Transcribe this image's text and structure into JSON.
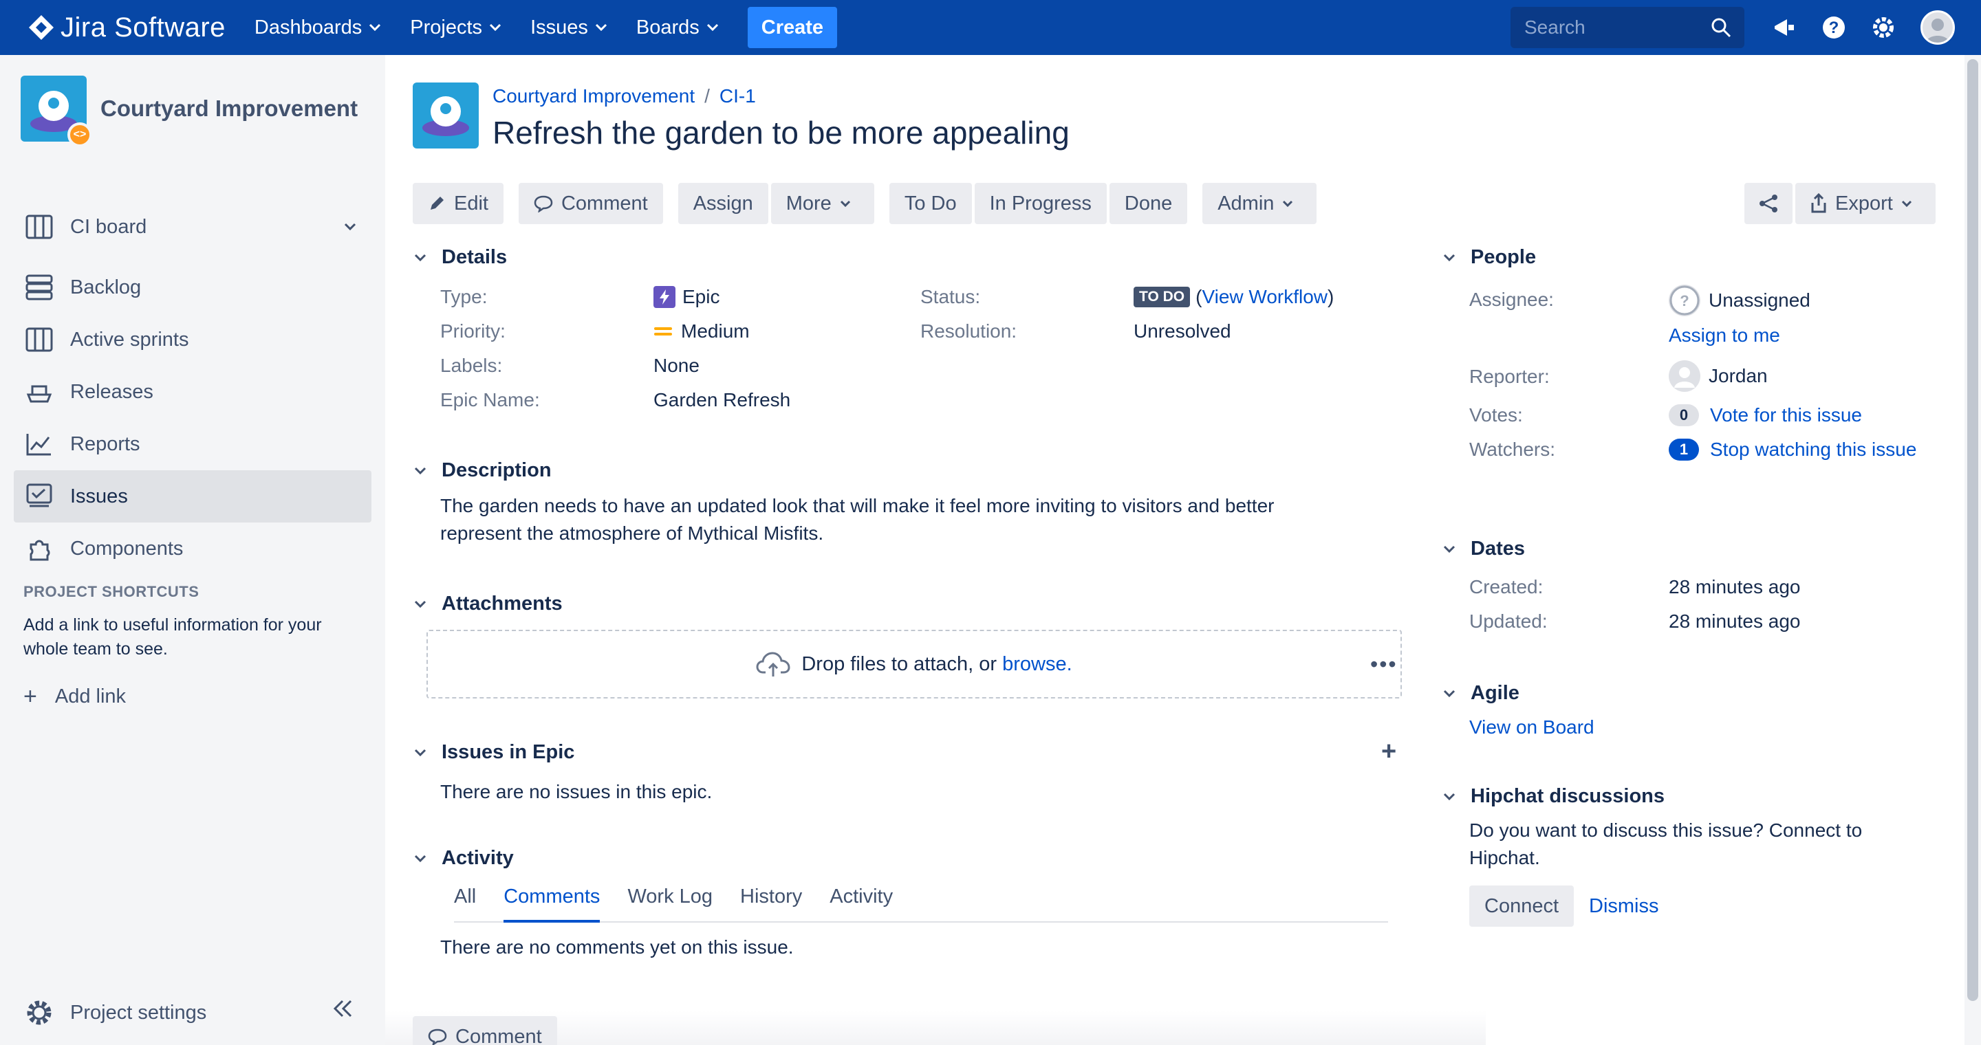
{
  "topnav": {
    "brand": "Jira Software",
    "items": [
      {
        "label": "Dashboards"
      },
      {
        "label": "Projects"
      },
      {
        "label": "Issues"
      },
      {
        "label": "Boards"
      }
    ],
    "create_label": "Create",
    "search_placeholder": "Search",
    "icons": [
      "notifications-icon",
      "help-icon",
      "settings-icon",
      "user-avatar"
    ]
  },
  "sidebar": {
    "project_name": "Courtyard Improvement",
    "board_label": "CI board",
    "items": [
      {
        "label": "Backlog",
        "icon": "backlog-icon"
      },
      {
        "label": "Active sprints",
        "icon": "board-icon"
      },
      {
        "label": "Releases",
        "icon": "ship-icon"
      },
      {
        "label": "Reports",
        "icon": "chart-icon"
      },
      {
        "label": "Issues",
        "icon": "issues-icon",
        "active": true
      },
      {
        "label": "Components",
        "icon": "puzzle-icon"
      }
    ],
    "shortcuts_title": "PROJECT SHORTCUTS",
    "shortcuts_text": "Add a link to useful information for your whole team to see.",
    "add_link": "Add link",
    "project_settings": "Project settings"
  },
  "issue": {
    "breadcrumb_project": "Courtyard Improvement",
    "breadcrumb_sep": "/",
    "key": "CI-1",
    "title": "Refresh the garden to be more appealing"
  },
  "toolbar": {
    "edit": "Edit",
    "comment": "Comment",
    "assign": "Assign",
    "more": "More",
    "todo": "To Do",
    "in_progress": "In Progress",
    "done": "Done",
    "admin": "Admin",
    "export": "Export"
  },
  "details": {
    "heading": "Details",
    "type_label": "Type:",
    "type_value": "Epic",
    "priority_label": "Priority:",
    "priority_value": "Medium",
    "labels_label": "Labels:",
    "labels_value": "None",
    "epic_name_label": "Epic Name:",
    "epic_name_value": "Garden Refresh",
    "status_label": "Status:",
    "status_value": "TO DO",
    "view_workflow": "View Workflow",
    "resolution_label": "Resolution:",
    "resolution_value": "Unresolved"
  },
  "description": {
    "heading": "Description",
    "text": "The garden needs to have an updated look that will make it feel more inviting to visitors and better represent the atmosphere of Mythical Misfits."
  },
  "attachments": {
    "heading": "Attachments",
    "drop_text": "Drop files to attach, or",
    "browse": "browse."
  },
  "epic_issues": {
    "heading": "Issues in Epic",
    "empty": "There are no issues in this epic."
  },
  "activity": {
    "heading": "Activity",
    "tabs": [
      {
        "label": "All"
      },
      {
        "label": "Comments",
        "active": true
      },
      {
        "label": "Work Log"
      },
      {
        "label": "History"
      },
      {
        "label": "Activity"
      }
    ],
    "empty": "There are no comments yet on this issue.",
    "comment_button": "Comment"
  },
  "people": {
    "heading": "People",
    "assignee_label": "Assignee:",
    "assignee_value": "Unassigned",
    "assign_to_me": "Assign to me",
    "reporter_label": "Reporter:",
    "reporter_value": "Jordan",
    "votes_label": "Votes:",
    "votes_count": "0",
    "vote_link": "Vote for this issue",
    "watchers_label": "Watchers:",
    "watchers_count": "1",
    "watch_link": "Stop watching this issue"
  },
  "dates": {
    "heading": "Dates",
    "created_label": "Created:",
    "created_value": "28 minutes ago",
    "updated_label": "Updated:",
    "updated_value": "28 minutes ago"
  },
  "agile": {
    "heading": "Agile",
    "link": "View on Board"
  },
  "hipchat": {
    "heading": "Hipchat discussions",
    "text": "Do you want to discuss this issue? Connect to Hipchat.",
    "connect": "Connect",
    "dismiss": "Dismiss"
  },
  "colors": {
    "nav_bg": "#0747a6",
    "create_bg": "#2684ff",
    "link": "#0052cc",
    "sidebar_bg": "#f4f5f7",
    "epic": "#6554c0",
    "medium_priority": "#ffab00"
  }
}
